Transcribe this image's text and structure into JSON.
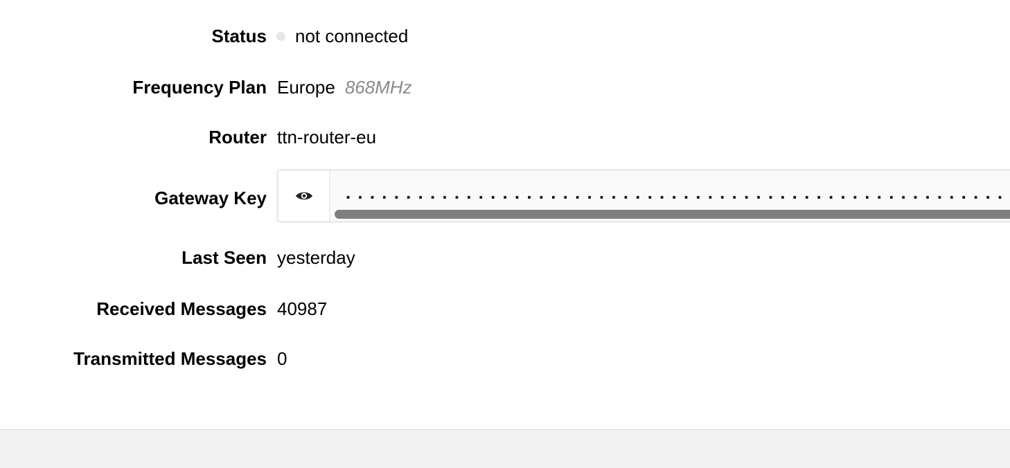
{
  "rows": {
    "status": {
      "label": "Status",
      "value": "not connected"
    },
    "frequency_plan": {
      "label": "Frequency Plan",
      "value": "Europe",
      "sub": "868MHz"
    },
    "router": {
      "label": "Router",
      "value": "ttn-router-eu"
    },
    "gateway_key": {
      "label": "Gateway Key",
      "masked": "............................................................"
    },
    "last_seen": {
      "label": "Last Seen",
      "value": "yesterday"
    },
    "received": {
      "label": "Received Messages",
      "value": "40987"
    },
    "transmitted": {
      "label": "Transmitted Messages",
      "value": "0"
    }
  },
  "colors": {
    "status_dot": "#e6e6e6",
    "muted_text": "#8a8a8a",
    "footer_bg": "#f2f2f2"
  },
  "icons": {
    "reveal_key": "eye-icon",
    "status": "status-dot-icon"
  }
}
